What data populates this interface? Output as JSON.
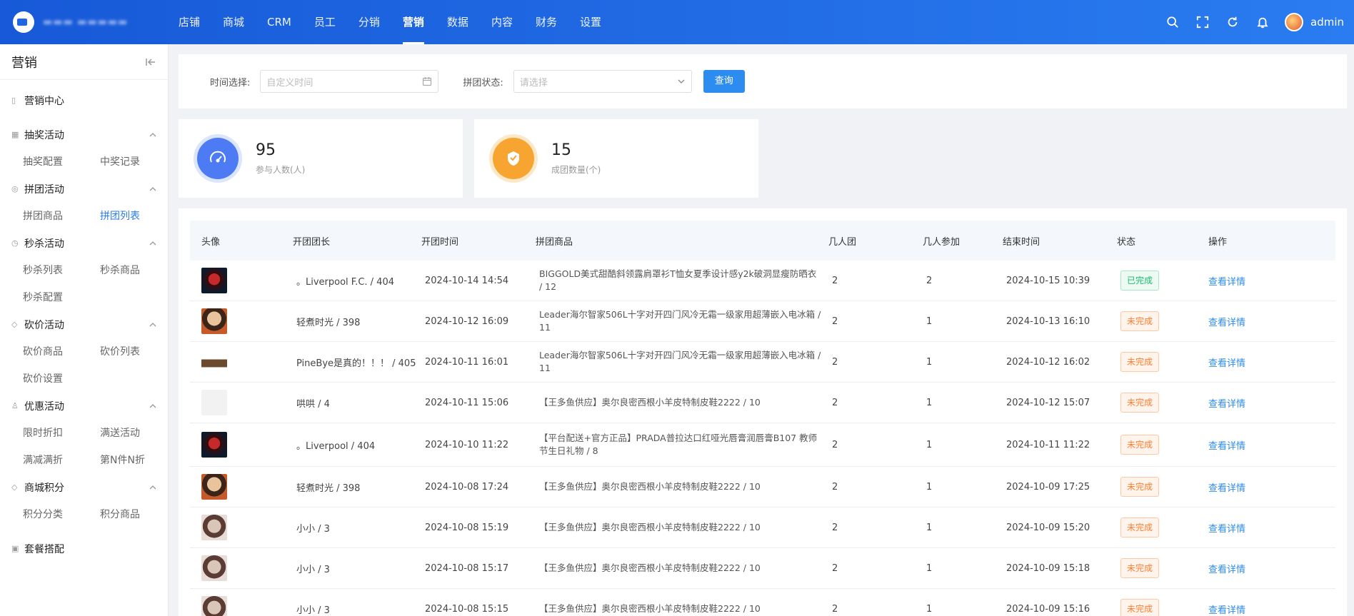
{
  "nav": {
    "items": [
      "店铺",
      "商城",
      "CRM",
      "员工",
      "分销",
      "营销",
      "数据",
      "内容",
      "财务",
      "设置"
    ],
    "active": "营销"
  },
  "user": {
    "name": "admin"
  },
  "sidebar": {
    "title": "营销",
    "center": "营销中心",
    "groups": [
      {
        "title": "抽奖活动",
        "items": [
          "抽奖配置",
          "中奖记录"
        ]
      },
      {
        "title": "拼团活动",
        "items": [
          "拼团商品",
          "拼团列表"
        ],
        "active": "拼团列表"
      },
      {
        "title": "秒杀活动",
        "items": [
          "秒杀列表",
          "秒杀商品",
          "秒杀配置"
        ]
      },
      {
        "title": "砍价活动",
        "items": [
          "砍价商品",
          "砍价列表",
          "砍价设置"
        ]
      },
      {
        "title": "优惠活动",
        "items": [
          "限时折扣",
          "满送活动",
          "满减满折",
          "第N件N折"
        ]
      },
      {
        "title": "商城积分",
        "items": [
          "积分分类",
          "积分商品"
        ]
      }
    ],
    "bottom": "套餐搭配"
  },
  "filter": {
    "time_label": "时间选择:",
    "time_placeholder": "自定义时间",
    "status_label": "拼团状态:",
    "status_placeholder": "请选择",
    "query_label": "查询"
  },
  "stats": [
    {
      "value": "95",
      "label": "参与人数(人)"
    },
    {
      "value": "15",
      "label": "成团数量(个)"
    }
  ],
  "table": {
    "headers": [
      "头像",
      "开团团长",
      "开团时间",
      "拼团商品",
      "几人团",
      "几人参加",
      "结束时间",
      "状态",
      "操作"
    ],
    "rows": [
      {
        "leader": "。Liverpool F.C. / 404",
        "start": "2024-10-14 14:54",
        "product": "BIGGOLD美式甜酷斜领露肩罩衫T恤女夏季设计感y2k破洞显瘦防晒衣 / 12",
        "group": "2",
        "joined": "2",
        "end": "2024-10-15 10:39",
        "status": "已完成",
        "action": "查看详情"
      },
      {
        "leader": "轻煮时光 / 398",
        "start": "2024-10-12 16:09",
        "product": "Leader海尔智家506L十字对开四门风冷无霜一级家用超薄嵌入电冰箱 / 11",
        "group": "2",
        "joined": "1",
        "end": "2024-10-13 16:10",
        "status": "未完成",
        "action": "查看详情"
      },
      {
        "leader": "PineBye是真的！！！ / 405",
        "start": "2024-10-11 16:01",
        "product": "Leader海尔智家506L十字对开四门风冷无霜一级家用超薄嵌入电冰箱 / 11",
        "group": "2",
        "joined": "1",
        "end": "2024-10-12 16:02",
        "status": "未完成",
        "action": "查看详情"
      },
      {
        "leader": "哄哄 / 4",
        "start": "2024-10-11 15:06",
        "product": "【王多鱼供应】奥尔良密西根小羊皮特制皮鞋2222 / 10",
        "group": "2",
        "joined": "1",
        "end": "2024-10-12 15:07",
        "status": "未完成",
        "action": "查看详情"
      },
      {
        "leader": "。Liverpool / 404",
        "start": "2024-10-10 11:22",
        "product": "【平台配送+官方正品】PRADA普拉达口红哑光唇膏润唇膏B107 教师节生日礼物 / 8",
        "group": "2",
        "joined": "1",
        "end": "2024-10-11 11:22",
        "status": "未完成",
        "action": "查看详情"
      },
      {
        "leader": "轻煮时光 / 398",
        "start": "2024-10-08 17:24",
        "product": "【王多鱼供应】奥尔良密西根小羊皮特制皮鞋2222 / 10",
        "group": "2",
        "joined": "1",
        "end": "2024-10-09 17:25",
        "status": "未完成",
        "action": "查看详情"
      },
      {
        "leader": "小小 / 3",
        "start": "2024-10-08 15:19",
        "product": "【王多鱼供应】奥尔良密西根小羊皮特制皮鞋2222 / 10",
        "group": "2",
        "joined": "1",
        "end": "2024-10-09 15:20",
        "status": "未完成",
        "action": "查看详情"
      },
      {
        "leader": "小小 / 3",
        "start": "2024-10-08 15:17",
        "product": "【王多鱼供应】奥尔良密西根小羊皮特制皮鞋2222 / 10",
        "group": "2",
        "joined": "1",
        "end": "2024-10-09 15:18",
        "status": "未完成",
        "action": "查看详情"
      },
      {
        "leader": "小小 / 3",
        "start": "2024-10-08 15:15",
        "product": "【王多鱼供应】奥尔良密西根小羊皮特制皮鞋2222 / 10",
        "group": "2",
        "joined": "1",
        "end": "2024-10-09 15:16",
        "status": "未完成",
        "action": "查看详情"
      }
    ]
  }
}
